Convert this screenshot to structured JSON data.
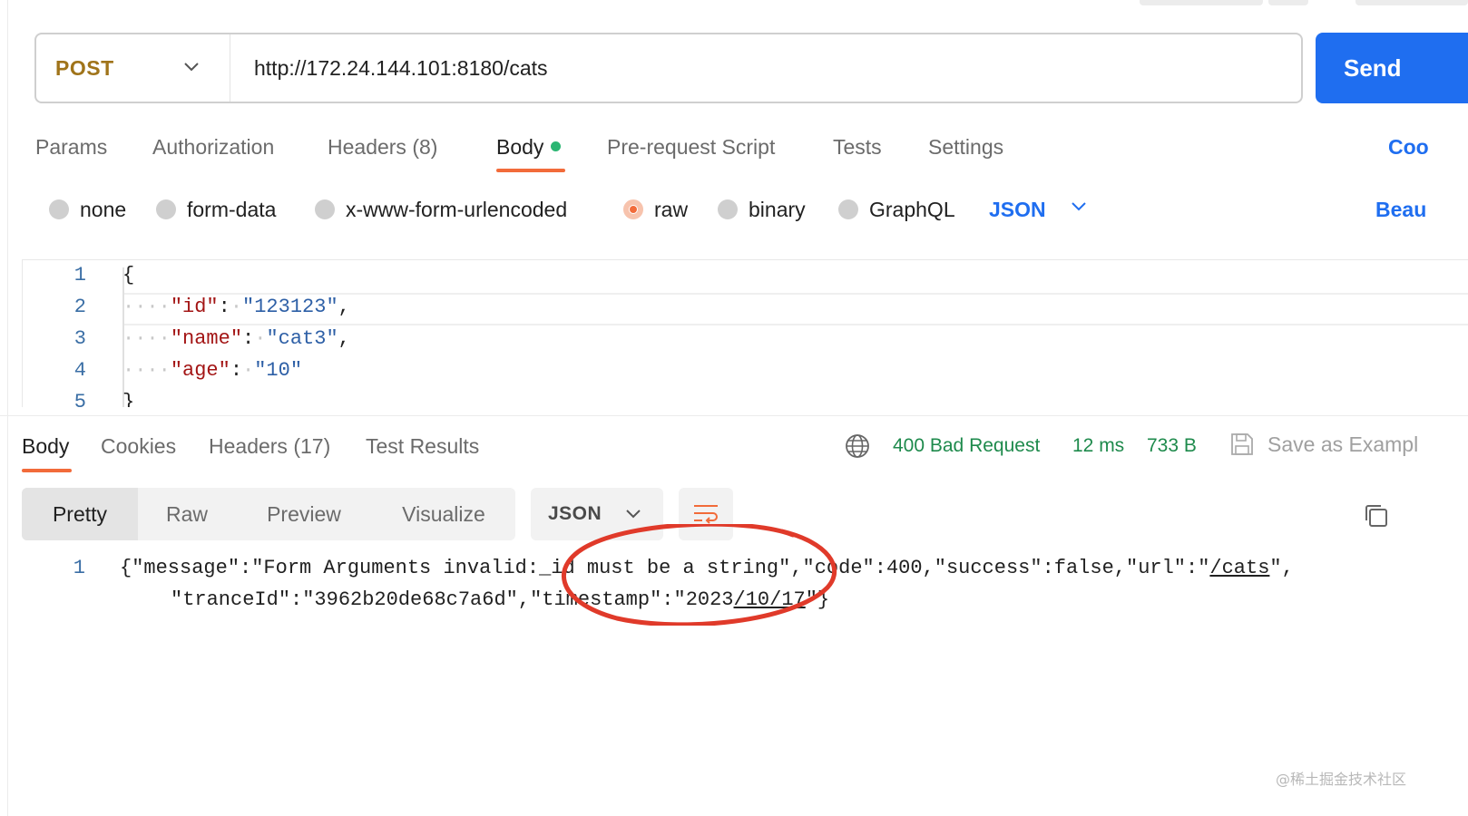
{
  "request": {
    "method": "POST",
    "url": "http://172.24.144.101:8180/cats",
    "send_label": "Send"
  },
  "request_tabs": [
    {
      "label": "Params"
    },
    {
      "label": "Authorization"
    },
    {
      "label": "Headers",
      "count": "(8)"
    },
    {
      "label": "Body",
      "active": true,
      "indicator_color": "#2bb673"
    },
    {
      "label": "Pre-request Script"
    },
    {
      "label": "Tests"
    },
    {
      "label": "Settings"
    }
  ],
  "cookies_link": "Coo",
  "body_types": [
    {
      "label": "none"
    },
    {
      "label": "form-data"
    },
    {
      "label": "x-www-form-urlencoded"
    },
    {
      "label": "raw",
      "selected": true
    },
    {
      "label": "binary"
    },
    {
      "label": "GraphQL"
    }
  ],
  "body_format": "JSON",
  "beautify_label": "Beau",
  "request_body": {
    "line_numbers": [
      "1",
      "2",
      "3",
      "4",
      "5"
    ],
    "open_brace": "{",
    "close_brace": "}",
    "fields": [
      {
        "key": "\"id\"",
        "value": "\"123123\"",
        "comma": ","
      },
      {
        "key": "\"name\"",
        "value": "\"cat3\"",
        "comma": ","
      },
      {
        "key": "\"age\"",
        "value": "\"10\"",
        "comma": ""
      }
    ]
  },
  "response_tabs": [
    {
      "label": "Body",
      "active": true
    },
    {
      "label": "Cookies"
    },
    {
      "label": "Headers",
      "count": "(17)"
    },
    {
      "label": "Test Results"
    }
  ],
  "response_status": {
    "status": "400 Bad Request",
    "time": "12 ms",
    "size": "733 B",
    "save_label": "Save as Exampl"
  },
  "view_modes": [
    "Pretty",
    "Raw",
    "Preview",
    "Visualize"
  ],
  "response_format": "JSON",
  "response_body": {
    "line_number": "1",
    "line1_a": "{\"message\":\"Form Arguments invalid:",
    "line1_b": "_id must be a string",
    "line1_c": "\",\"code\":400,\"success\":false,\"url\":\"",
    "line1_url": "/cats",
    "line1_d": "\",",
    "line2_a": "\"tranceId\":\"3962b20de68c7a6d\",\"timestamp\":\"2023",
    "line2_date": "/10/17",
    "line2_b": "\"}"
  },
  "colors": {
    "accent": "#1f6ef0",
    "method": "#a0741a",
    "tab_underline": "#f26b3a",
    "status_ok_text": "#1e8a4c",
    "annotation": "#e03a2a"
  },
  "watermark": "@稀土掘金技术社区"
}
